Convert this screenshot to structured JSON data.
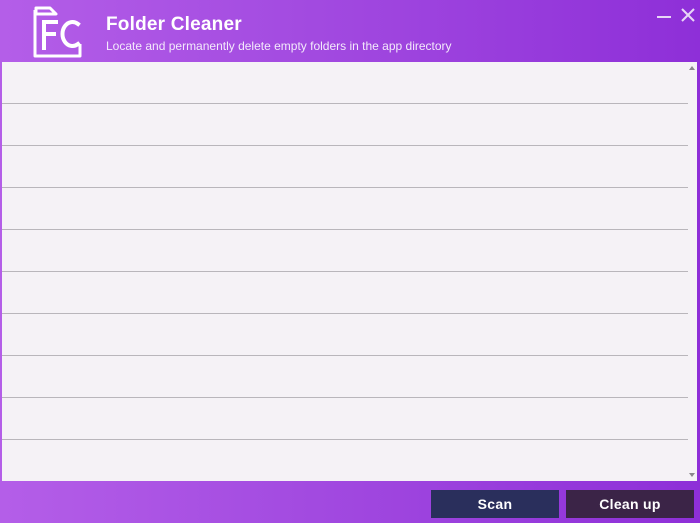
{
  "app": {
    "title": "Folder Cleaner",
    "subtitle": "Locate and permanently delete empty folders in the app directory",
    "logo_text": "FC"
  },
  "window_controls": {
    "minimize_icon": "minimize-icon",
    "close_icon": "close-icon"
  },
  "list": {
    "rows": [
      "",
      "",
      "",
      "",
      "",
      "",
      "",
      "",
      "",
      ""
    ]
  },
  "footer": {
    "scan_label": "Scan",
    "cleanup_label": "Clean up"
  },
  "colors": {
    "header_start": "#b45ee8",
    "header_end": "#8e2fd8",
    "list_bg": "#f5f2f6",
    "scan_button": "#2a2f5c",
    "cleanup_button": "#3b2447"
  }
}
